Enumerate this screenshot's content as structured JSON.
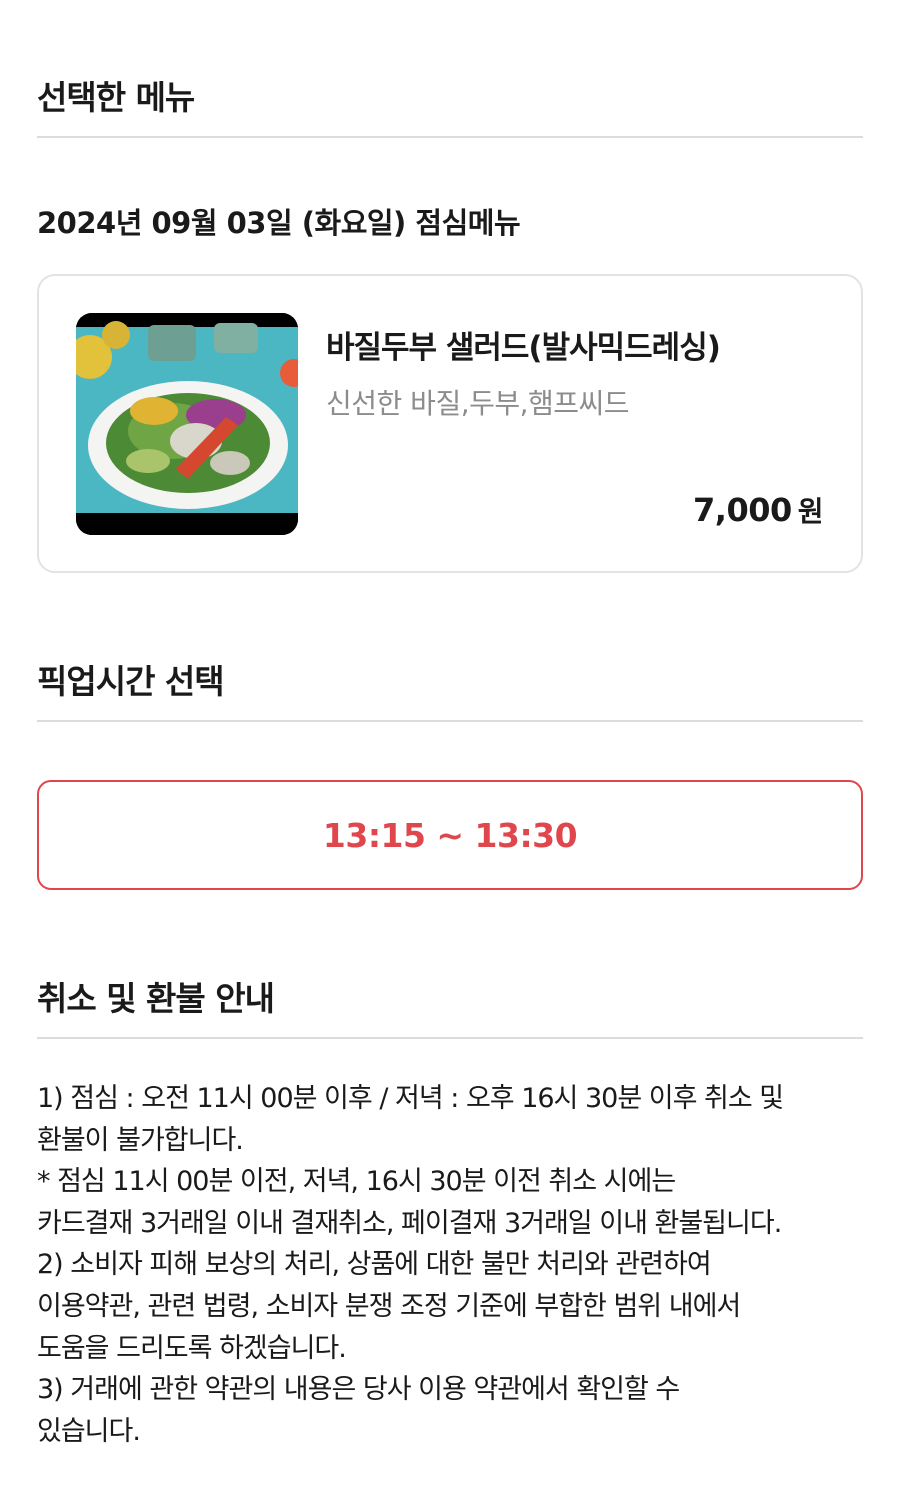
{
  "selected_menu": {
    "section_title": "선택한 메뉴",
    "date_label": "2024년 09월 03일 (화요일) 점심메뉴",
    "item": {
      "image_icon": "salad-photo",
      "name": "바질두부 샐러드(발사믹드레싱)",
      "description": "신선한 바질,두부,햄프씨드",
      "price": "7,000",
      "price_unit": "원"
    }
  },
  "pickup": {
    "section_title": "픽업시간 선택",
    "selected_time": "13:15 ~ 13:30",
    "accent_color": "#e0474c"
  },
  "refund": {
    "section_title": "취소 및 환불 안내",
    "lines": [
      "1) 점심 : 오전 11시 00분 이후 / 저녁 : 오후 16시 30분 이후 취소 및",
      "환불이 불가합니다.",
      "* 점심 11시 00분 이전, 저녁, 16시 30분 이전 취소 시에는",
      "카드결재 3거래일 이내 결재취소, 페이결재 3거래일 이내 환불됩니다.",
      "2) 소비자 피해 보상의 처리, 상품에 대한 불만 처리와 관련하여",
      "이용약관, 관련 법령, 소비자 분쟁 조정 기준에 부합한 범위 내에서",
      "도움을 드리도록 하겠습니다.",
      "3) 거래에 관한 약관의 내용은 당사 이용 약관에서 확인할 수",
      "있습니다."
    ]
  }
}
